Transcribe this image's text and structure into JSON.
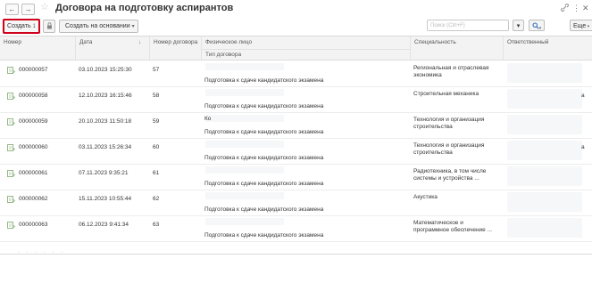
{
  "window": {
    "title": "Договора на подготовку аспирантов",
    "link_icon": "link-icon",
    "more_icon": "more-icon",
    "close_icon": "close-icon"
  },
  "nav": {
    "back": "←",
    "forward": "→",
    "star": "☆"
  },
  "toolbar": {
    "create_label": "Создать",
    "create_shortcut": "1",
    "basis_label": "Создать на основании",
    "search_placeholder": "Поиск (Ctrl+F)",
    "search_button": "▾",
    "find_button": "🔍",
    "more_label": "Еще"
  },
  "columns": {
    "number": "Номер",
    "date": "Дата",
    "contract_number": "Номер договора",
    "person": "Физическое лицо",
    "contract_type": "Тип договора",
    "specialty": "Специальность",
    "responsible": "Ответственный"
  },
  "rows": [
    {
      "number": "000000057",
      "date": "03.10.2023 15:25:30",
      "contract": "57",
      "person": "",
      "type": "Подготовка к сдаче кандидатского экзамена",
      "spec1": "Региональная и отраслевая",
      "spec2": "экономика",
      "resp": ""
    },
    {
      "number": "000000058",
      "date": "12.10.2023 16:15:46",
      "contract": "58",
      "person": "",
      "type": "Подготовка к сдаче кандидатского экзамена",
      "spec1": "Строительная механика",
      "spec2": "",
      "resp": "а"
    },
    {
      "number": "000000059",
      "date": "20.10.2023 11:50:18",
      "contract": "59",
      "person": "Ко",
      "type": "Подготовка к сдаче кандидатского экзамена",
      "spec1": "Технология и организация",
      "spec2": "строительства",
      "resp": ""
    },
    {
      "number": "000000060",
      "date": "03.11.2023 15:26:34",
      "contract": "60",
      "person": "",
      "type": "Подготовка к сдаче кандидатского экзамена",
      "spec1": "Технология и организация",
      "spec2": "строительства",
      "resp": "а"
    },
    {
      "number": "000000061",
      "date": "07.11.2023 9:35:21",
      "contract": "61",
      "person": "",
      "type": "Подготовка к сдаче кандидатского экзамена",
      "spec1": "Радиотехника, в том числе",
      "spec2": "системы и устройства ...",
      "resp": ""
    },
    {
      "number": "000000062",
      "date": "15.11.2023 10:55:44",
      "contract": "62",
      "person": "",
      "type": "Подготовка к сдаче кандидатского экзамена",
      "spec1": "Акустика",
      "spec2": "",
      "resp": ""
    },
    {
      "number": "000000063",
      "date": "06.12.2023 9:41:34",
      "contract": "63",
      "person": "",
      "type": "Подготовка к сдаче кандидатского экзамена",
      "spec1": "Математическое и",
      "spec2": "программное обеспечение ...",
      "resp": ""
    }
  ],
  "colors": {
    "accent_border": "#d0021b",
    "header_bg": "#f3f3f3"
  }
}
